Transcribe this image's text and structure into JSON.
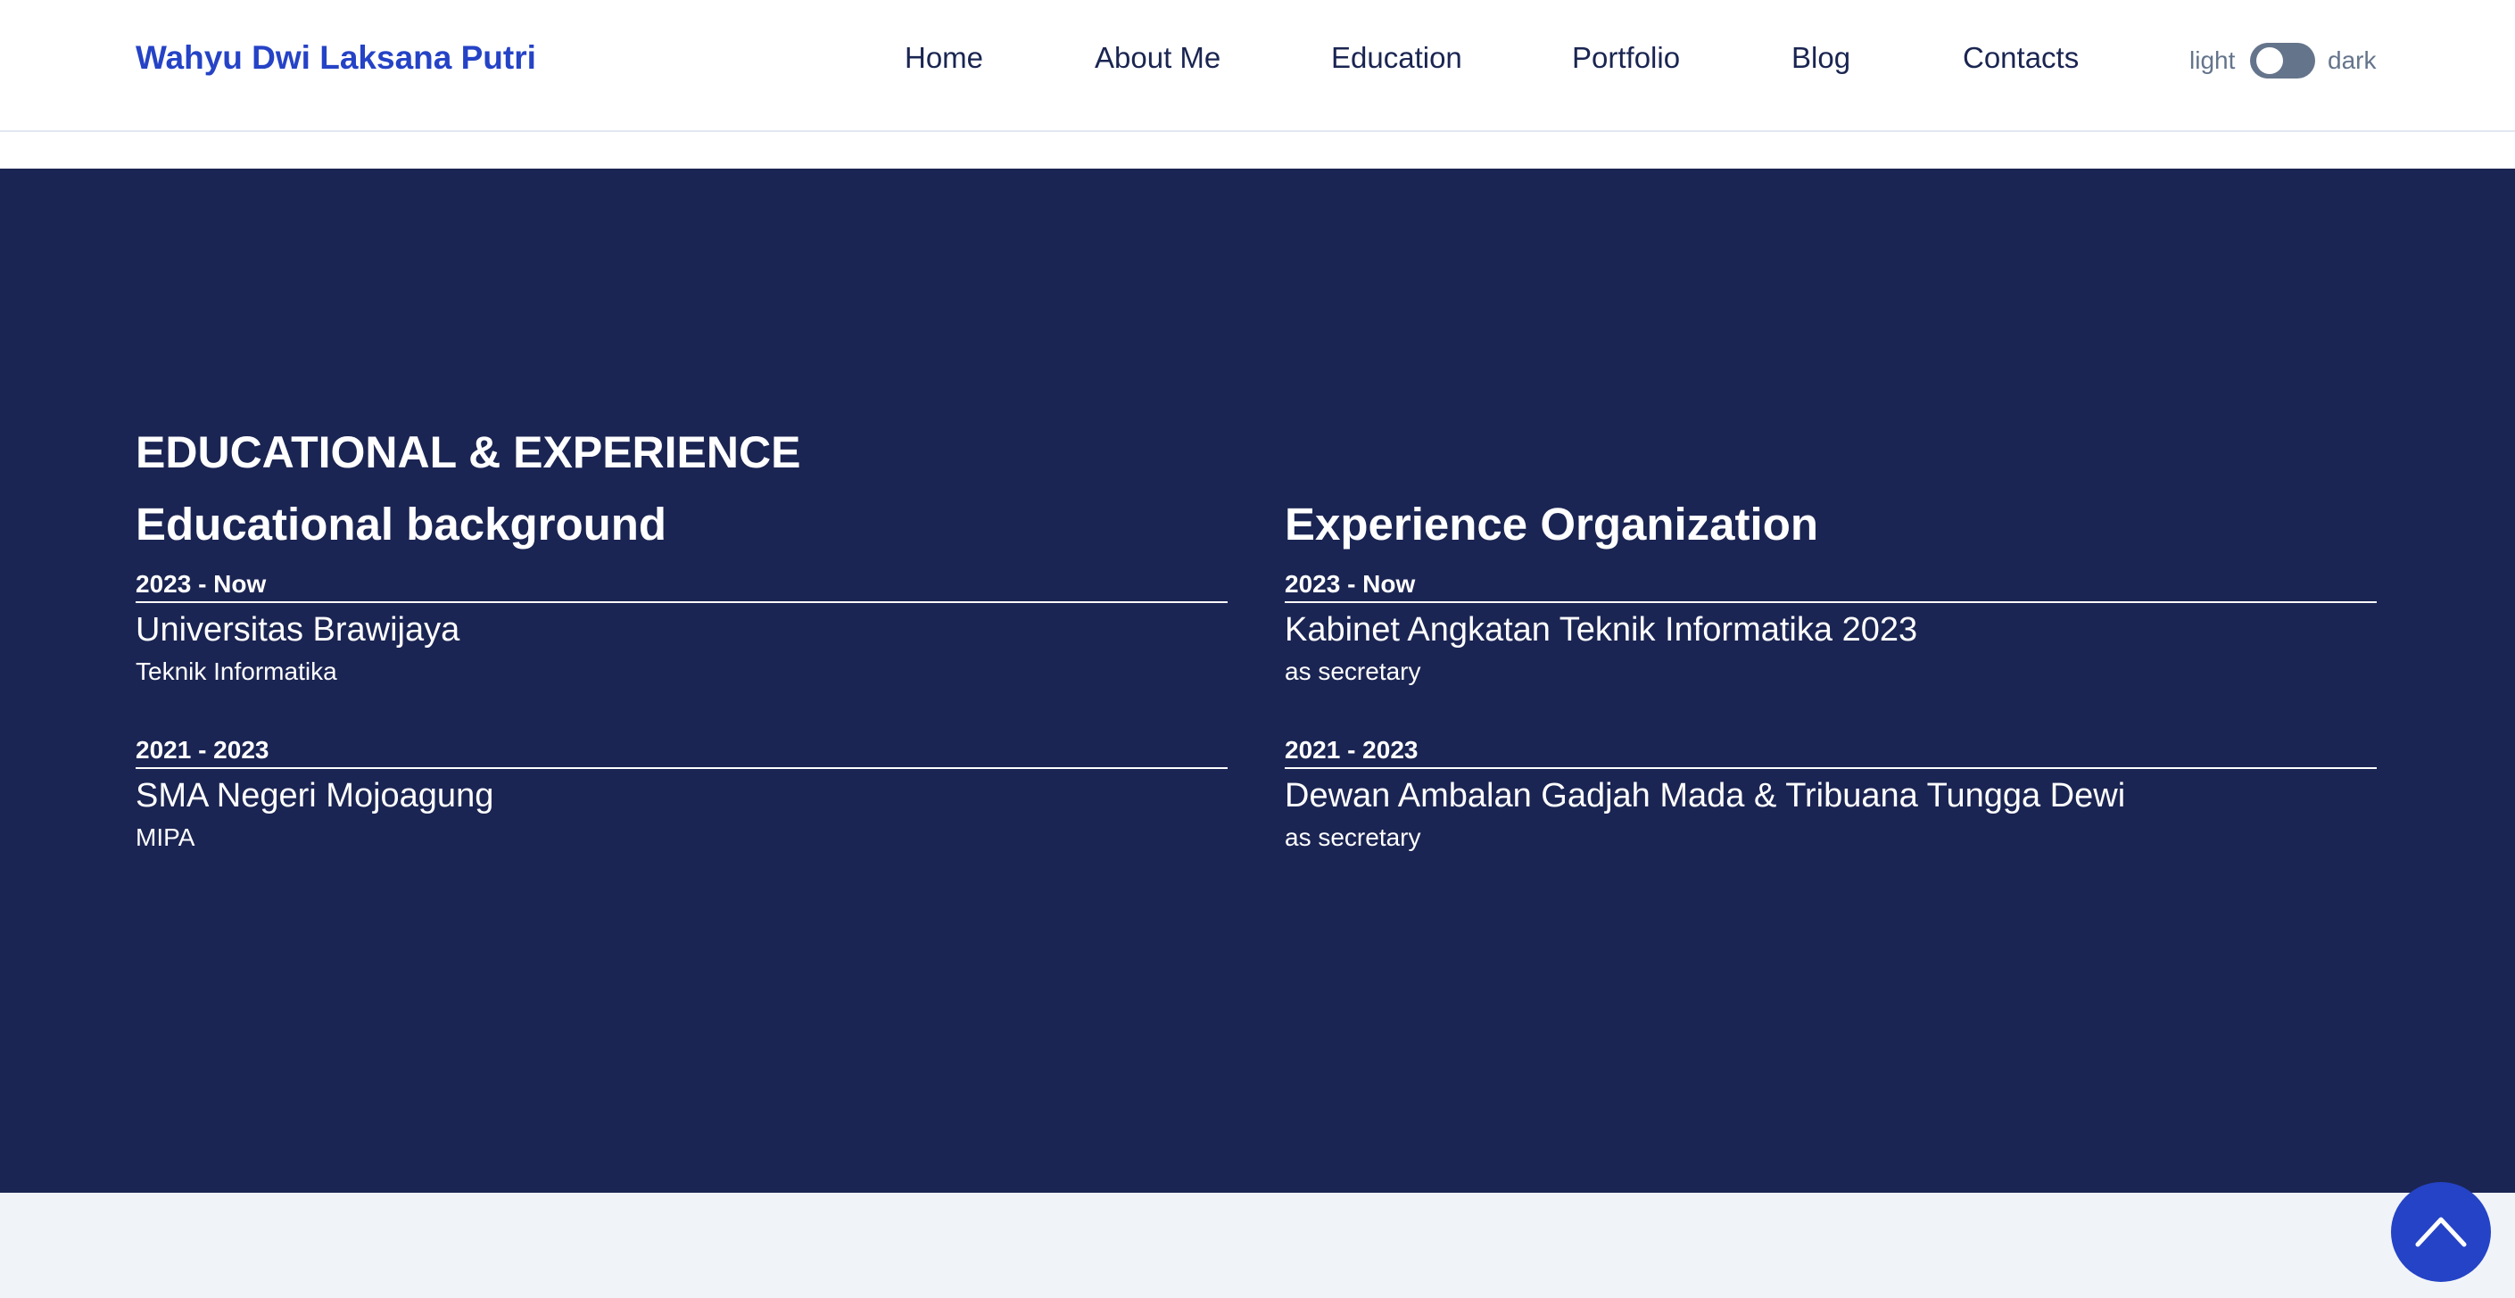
{
  "header": {
    "brand": "Wahyu Dwi Laksana Putri",
    "nav": [
      "Home",
      "About Me",
      "Education",
      "Portfolio",
      "Blog",
      "Contacts"
    ],
    "theme_toggle": {
      "light_label": "light",
      "dark_label": "dark",
      "state": "light"
    }
  },
  "section": {
    "title": "EDUCATIONAL & EXPERIENCE",
    "education": {
      "heading": "Educational background",
      "items": [
        {
          "period": "2023 - Now",
          "name": "Universitas Brawijaya",
          "detail": "Teknik Informatika"
        },
        {
          "period": "2021 - 2023",
          "name": "SMA Negeri Mojoagung",
          "detail": "MIPA"
        }
      ]
    },
    "experience": {
      "heading": "Experience Organization",
      "items": [
        {
          "period": "2023 - Now",
          "name": "Kabinet Angkatan Teknik Informatika 2023",
          "detail": "as secretary"
        },
        {
          "period": "2021 - 2023",
          "name": "Dewan Ambalan Gadjah Mada & Tribuana Tungga Dewi",
          "detail": "as secretary"
        }
      ]
    }
  },
  "scroll_top": {
    "icon": "chevron-up-icon"
  },
  "colors": {
    "brand": "#2543c6",
    "section_bg": "#1b2553",
    "nav_text": "#1a2551",
    "toggle_track": "#64748b",
    "footer_bg": "#f0f4f8"
  }
}
